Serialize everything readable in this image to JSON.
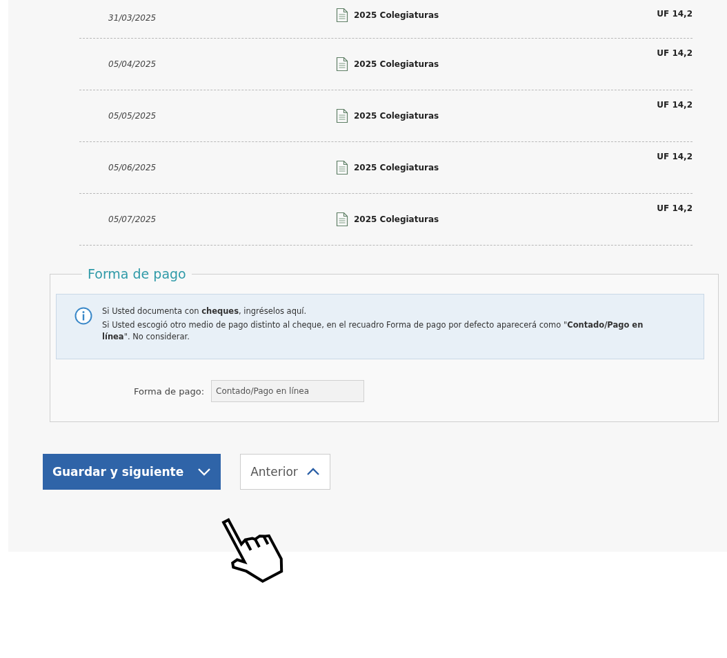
{
  "payments": [
    {
      "date": "31/03/2025",
      "description": "2025 Colegiaturas",
      "amount": "UF 14,2"
    },
    {
      "date": "05/04/2025",
      "description": "2025 Colegiaturas",
      "amount": "UF 14,2"
    },
    {
      "date": "05/05/2025",
      "description": "2025 Colegiaturas",
      "amount": "UF 14,2"
    },
    {
      "date": "05/06/2025",
      "description": "2025 Colegiaturas",
      "amount": "UF 14,2"
    },
    {
      "date": "05/07/2025",
      "description": "2025 Colegiaturas",
      "amount": "UF 14,2"
    }
  ],
  "payment_method": {
    "legend": "Forma de pago",
    "info_lines": [
      "Si Usted documenta con **cheques**, ingréselos aquí.",
      "Si Usted escogió otro medio de pago distinto al cheque, en el recuadro Forma de pago por defecto aparecerá como \"**Contado/Pago en línea**\". No considerar."
    ],
    "field_label": "Forma de pago:",
    "field_value": "Contado/Pago en línea"
  },
  "buttons": [
    {
      "label": "Guardar y siguiente",
      "kind": "primary"
    },
    {
      "label": "Anterior",
      "kind": "secondary"
    }
  ]
}
